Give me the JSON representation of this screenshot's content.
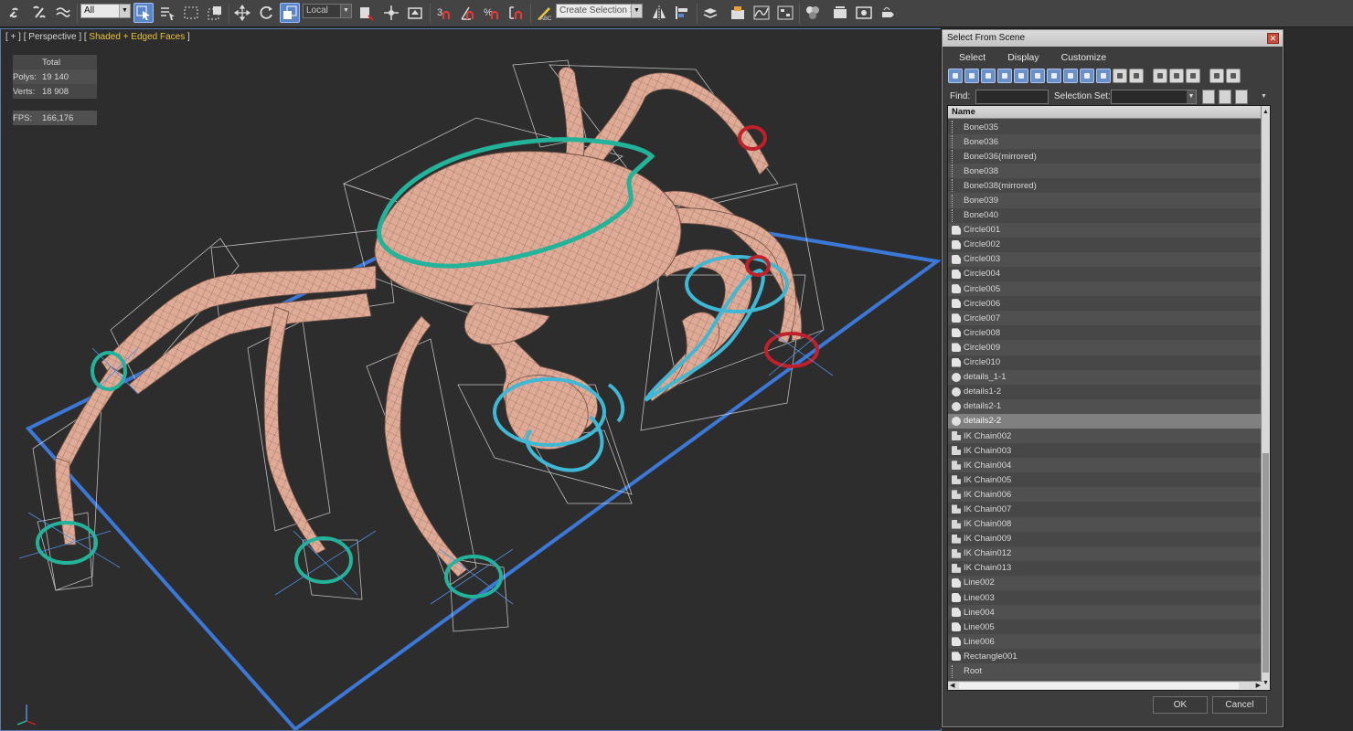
{
  "toolbar": {
    "filter_value": "All",
    "coord_system": "Local",
    "selection_set_placeholder": "Create Selection Se",
    "snap_3_label": "3",
    "snap_angle_label": "%",
    "icons": [
      "link-icon",
      "unlink-icon",
      "bind-spacewarp-icon",
      "select-object-icon",
      "select-by-name-icon",
      "rect-selection-icon",
      "window-crossing-icon",
      "move-icon",
      "rotate-icon",
      "scale-icon",
      "select-manipulate-icon",
      "pivot-icon",
      "snap-toggle-icon",
      "angle-snap-icon",
      "percent-snap-icon",
      "spinner-snap-icon",
      "edit-named-sets-icon",
      "mirror-icon",
      "align-icon",
      "layer-manager-icon",
      "graphite-icon",
      "curve-editor-icon",
      "schematic-icon",
      "material-editor-icon",
      "render-setup-icon",
      "rendered-frame-icon",
      "render-icon"
    ]
  },
  "viewport": {
    "label_prefix": "[ + ] [ Perspective ] [",
    "label_shading": " Shaded + Edged Faces ",
    "label_suffix": "]",
    "stats": {
      "total_label": "Total",
      "polys_label": "Polys:",
      "polys_value": "19 140",
      "verts_label": "Verts:",
      "verts_value": "18 908",
      "fps_label": "FPS:",
      "fps_value": "166,176"
    }
  },
  "dialog": {
    "title": "Select From Scene",
    "menu": [
      "Select",
      "Display",
      "Customize"
    ],
    "find_label": "Find:",
    "find_value": "",
    "selection_set_label": "Selection Set:",
    "column_header": "Name",
    "items": [
      {
        "name": "Bone035",
        "type": "bone"
      },
      {
        "name": "Bone036",
        "type": "bone"
      },
      {
        "name": "Bone036(mirrored)",
        "type": "bone"
      },
      {
        "name": "Bone038",
        "type": "bone"
      },
      {
        "name": "Bone038(mirrored)",
        "type": "bone"
      },
      {
        "name": "Bone039",
        "type": "bone"
      },
      {
        "name": "Bone040",
        "type": "bone"
      },
      {
        "name": "Circle001",
        "type": "shape"
      },
      {
        "name": "Circle002",
        "type": "shape"
      },
      {
        "name": "Circle003",
        "type": "shape"
      },
      {
        "name": "Circle004",
        "type": "shape"
      },
      {
        "name": "Circle005",
        "type": "shape"
      },
      {
        "name": "Circle006",
        "type": "shape"
      },
      {
        "name": "Circle007",
        "type": "shape"
      },
      {
        "name": "Circle008",
        "type": "shape"
      },
      {
        "name": "Circle009",
        "type": "shape"
      },
      {
        "name": "Circle010",
        "type": "shape"
      },
      {
        "name": "details_1-1",
        "type": "sphere"
      },
      {
        "name": "details1-2",
        "type": "sphere"
      },
      {
        "name": "details2-1",
        "type": "sphere"
      },
      {
        "name": "details2-2",
        "type": "sphere",
        "selected": true
      },
      {
        "name": "IK Chain002",
        "type": "ik"
      },
      {
        "name": "IK Chain003",
        "type": "ik"
      },
      {
        "name": "IK Chain004",
        "type": "ik"
      },
      {
        "name": "IK Chain005",
        "type": "ik"
      },
      {
        "name": "IK Chain006",
        "type": "ik"
      },
      {
        "name": "IK Chain007",
        "type": "ik"
      },
      {
        "name": "IK Chain008",
        "type": "ik"
      },
      {
        "name": "IK Chain009",
        "type": "ik"
      },
      {
        "name": "IK Chain012",
        "type": "ik"
      },
      {
        "name": "IK Chain013",
        "type": "ik"
      },
      {
        "name": "Line002",
        "type": "shape"
      },
      {
        "name": "Line003",
        "type": "shape"
      },
      {
        "name": "Line004",
        "type": "shape"
      },
      {
        "name": "Line005",
        "type": "shape"
      },
      {
        "name": "Line006",
        "type": "shape"
      },
      {
        "name": "Rectangle001",
        "type": "shape"
      },
      {
        "name": "Root",
        "type": "root"
      }
    ],
    "ok_label": "OK",
    "cancel_label": "Cancel"
  },
  "colors": {
    "accent_select": "#5a86c8",
    "stats_text": "#e2c84d",
    "ground_plane": "#3b78d8",
    "body_mesh": "#e0ab96",
    "control_green": "#22b39a",
    "control_cyan": "#3fb8d6",
    "control_red": "#c0202a"
  }
}
